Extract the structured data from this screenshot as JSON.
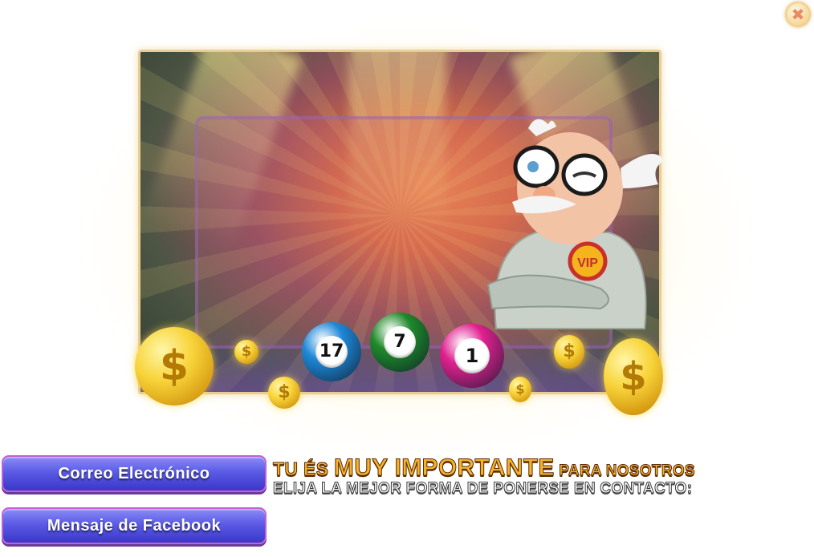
{
  "close": {
    "icon": "close-icon",
    "glyph": "✖"
  },
  "balls": [
    {
      "number": "17",
      "color": "#1e88d8"
    },
    {
      "number": "7",
      "color": "#1f8a2a"
    },
    {
      "number": "1",
      "color": "#e0208f"
    }
  ],
  "badge": {
    "text": "VIP"
  },
  "coin_symbol": "$",
  "buttons": {
    "email": "Correo Electrónico",
    "facebook": "Mensaje de Facebook"
  },
  "headline": {
    "part1": "TU ÉS ",
    "part2": "MUY IMPORTANTE",
    "part3": " PARA NOSOTROS",
    "line2": "ELIJA LA MEJOR FORMA DE PONERSE EN CONTACTO:"
  }
}
